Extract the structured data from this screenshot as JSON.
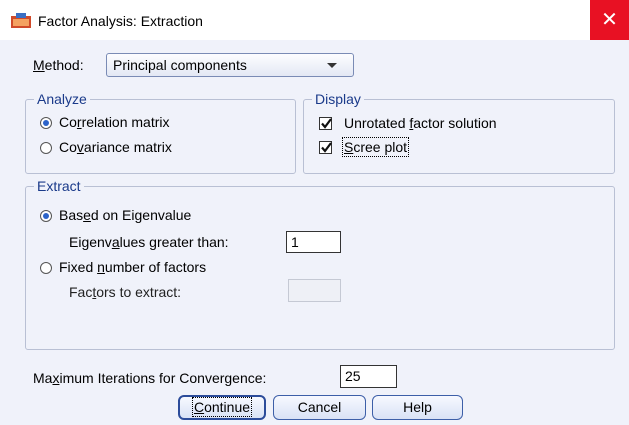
{
  "window": {
    "title": "Factor Analysis: Extraction",
    "close_glyph": "✕",
    "close_color": "#e81123",
    "app_icon": "spss-dialog-icon"
  },
  "method": {
    "label_u": "M",
    "label_rest": "ethod:",
    "selected": "Principal components"
  },
  "analyze": {
    "legend": "Analyze",
    "correlation": {
      "pre": "Co",
      "u": "r",
      "post": "relation matrix",
      "selected": true
    },
    "covariance": {
      "pre": "Co",
      "u": "v",
      "post": "ariance matrix",
      "selected": false
    }
  },
  "display": {
    "legend": "Display",
    "unrotated": {
      "pre": "Unrotated ",
      "u": "f",
      "post": "actor solution",
      "checked": true
    },
    "scree": {
      "pre": "",
      "u": "S",
      "post": "cree plot",
      "checked": true
    }
  },
  "extract": {
    "legend": "Extract",
    "eigenvalue_option": {
      "pre": "Bas",
      "u": "e",
      "post": "d on Eigenvalue",
      "selected": true
    },
    "eigen_label": {
      "pre": "Eigenv",
      "u": "a",
      "post": "lues greater than:"
    },
    "eigen_value": "1",
    "fixed_option": {
      "pre": "Fixed ",
      "u": "n",
      "post": "umber of factors",
      "selected": false
    },
    "factors_label": {
      "pre": "Fac",
      "u": "t",
      "post": "ors to extract:"
    },
    "factors_value": ""
  },
  "iterations": {
    "label_pre": "Ma",
    "label_u": "x",
    "label_post": "imum Iterations for Convergence:",
    "value": "25"
  },
  "buttons": {
    "continue": {
      "u": "C",
      "post": "ontinue"
    },
    "cancel": "Cancel",
    "help": "Help"
  }
}
